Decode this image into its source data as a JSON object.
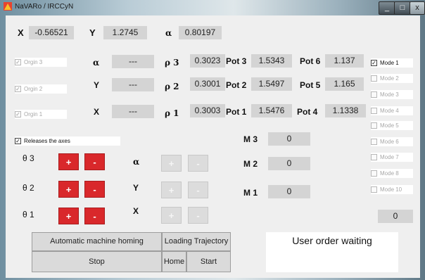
{
  "window": {
    "title": "NaVARo / IRCCyN",
    "minimize": "_",
    "maximize": "□",
    "close": "x"
  },
  "position": {
    "x_label": "X",
    "x_value": "-0.56521",
    "y_label": "Y",
    "y_value": "1.2745",
    "alpha_label": "α",
    "alpha_value": "0.80197"
  },
  "origins": {
    "orgin3": "Orgin 3",
    "orgin2": "Orgin 2",
    "orgin1": "Orgin 1"
  },
  "coords": [
    {
      "label": "α",
      "value": "---"
    },
    {
      "label": "Y",
      "value": "---"
    },
    {
      "label": "X",
      "value": "---"
    }
  ],
  "rho": [
    {
      "label": "ρ 3",
      "value": "0.3023"
    },
    {
      "label": "ρ 2",
      "value": "0.3001"
    },
    {
      "label": "ρ 1",
      "value": "0.3003"
    }
  ],
  "pots_left": [
    {
      "label": "Pot 3",
      "value": "1.5343"
    },
    {
      "label": "Pot 2",
      "value": "1.5497"
    },
    {
      "label": "Pot 1",
      "value": "1.5476"
    }
  ],
  "pots_right": [
    {
      "label": "Pot 6",
      "value": "1.137"
    },
    {
      "label": "Pot 5",
      "value": "1.165"
    },
    {
      "label": "Pot 4",
      "value": "1.1338"
    }
  ],
  "modes": [
    "Mode 1",
    "Mode 2",
    "Mode 3",
    "Mode 4",
    "Mode 5",
    "Mode 6",
    "Mode 7",
    "Mode 8",
    "Mode 10"
  ],
  "mode_value": "0",
  "release_axes": "Releases the axes",
  "theta": [
    {
      "label": "θ 3",
      "plus": "+",
      "minus": "-"
    },
    {
      "label": "θ 2",
      "plus": "+",
      "minus": "-"
    },
    {
      "label": "θ 1",
      "plus": "+",
      "minus": "-"
    }
  ],
  "cart": [
    {
      "label": "α",
      "plus": "+",
      "minus": "-"
    },
    {
      "label": "Y",
      "plus": "+",
      "minus": "-"
    },
    {
      "label": "X",
      "plus": "+",
      "minus": "-"
    }
  ],
  "motors": [
    {
      "label": "M 3",
      "value": "0"
    },
    {
      "label": "M 2",
      "value": "0"
    },
    {
      "label": "M 1",
      "value": "0"
    }
  ],
  "buttons": {
    "homing": "Automatic machine homing",
    "loading": "Loading Trajectory",
    "stop": "Stop",
    "home": "Home",
    "start": "Start"
  },
  "status": "User order waiting",
  "colors": {
    "accent_red": "#d9282b",
    "panel": "#efefef",
    "value_bg": "#d4d4d4"
  }
}
